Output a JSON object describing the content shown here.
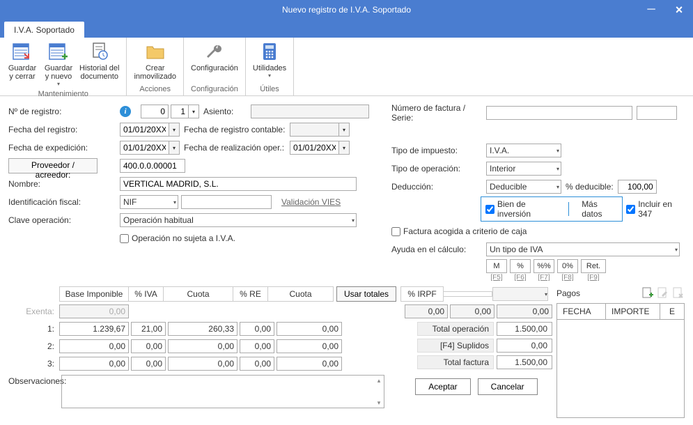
{
  "title": "Nuevo registro de I.V.A. Soportado",
  "tabs": {
    "iva_soportado": "I.V.A. Soportado"
  },
  "ribbon": {
    "mantenimiento": {
      "guardar_cerrar": "Guardar\ny cerrar",
      "guardar_nuevo": "Guardar\ny nuevo",
      "historial": "Historial del\ndocumento",
      "title": "Mantenimiento"
    },
    "acciones": {
      "crear_inmov": "Crear\ninmovilizado",
      "title": "Acciones"
    },
    "configuracion": {
      "config": "Configuración",
      "title": "Configuración"
    },
    "utiles": {
      "utilidades": "Utilidades",
      "title": "Útiles"
    }
  },
  "labels": {
    "n_registro": "Nº de registro:",
    "fecha_registro": "Fecha del registro:",
    "fecha_expedicion": "Fecha de expedición:",
    "proveedor": "Proveedor / acreedor:",
    "nombre": "Nombre:",
    "id_fiscal": "Identificación fiscal:",
    "clave_op": "Clave operación:",
    "asiento": "Asiento:",
    "fecha_reg_contable": "Fecha de registro contable:",
    "fecha_real_oper": "Fecha de realización oper.:",
    "op_no_sujeta": "Operación no sujeta a I.V.A.",
    "num_factura": "Número de factura / Serie:",
    "tipo_impuesto": "Tipo de impuesto:",
    "tipo_operacion": "Tipo de operación:",
    "deduccion": "Deducción:",
    "pct_deducible": "% deducible:",
    "bien_inversion": "Bien de inversión",
    "mas_datos": "Más datos",
    "incluir_347": "Incluir en 347",
    "factura_caja": "Factura acogida a criterio de caja",
    "ayuda_calculo": "Ayuda en el cálculo:",
    "validacion_vies": "Validación VIES",
    "observaciones": "Observaciones:",
    "usar_totales": "Usar totales",
    "pagos": "Pagos"
  },
  "values": {
    "n_registro_a": "0",
    "n_registro_b": "1",
    "fecha_registro": "01/01/20XX",
    "fecha_expedicion": "01/01/20XX",
    "fecha_real_oper": "01/01/20XX",
    "proveedor": "400.0.0.00001",
    "nombre": "VERTICAL MADRID, S.L.",
    "id_fiscal_tipo": "NIF",
    "clave_op": "Operación habitual",
    "tipo_impuesto": "I.V.A.",
    "tipo_operacion": "Interior",
    "deduccion": "Deducible",
    "pct_deducible": "100,00",
    "ayuda_calculo": "Un tipo de IVA",
    "incluir_347": true,
    "bien_inversion": true
  },
  "calc_btns": {
    "m": "M",
    "pct": "%",
    "pctpct": "%%",
    "zero": "0%",
    "ret": "Ret.",
    "f5": "[F5]",
    "f6": "[F6]",
    "f7": "[F7]",
    "f8": "[F8]",
    "f9": "[F9]"
  },
  "grid": {
    "headers": {
      "base": "Base Imponible",
      "pct_iva": "% IVA",
      "cuota": "Cuota",
      "pct_re": "% RE",
      "cuota2": "Cuota",
      "pct_irpf": "% IRPF"
    },
    "rows": {
      "exenta": {
        "label": "Exenta:",
        "base": "0,00"
      },
      "r1": {
        "label": "1:",
        "base": "1.239,67",
        "piva": "21,00",
        "cuota": "260,33",
        "pre": "0,00",
        "cuota2": "0,00"
      },
      "r2": {
        "label": "2:",
        "base": "0,00",
        "piva": "0,00",
        "cuota": "0,00",
        "pre": "0,00",
        "cuota2": "0,00"
      },
      "r3": {
        "label": "3:",
        "base": "0,00",
        "piva": "0,00",
        "cuota": "0,00",
        "pre": "0,00",
        "cuota2": "0,00"
      }
    },
    "irpf_vals": {
      "a": "0,00",
      "b": "0,00",
      "c": "0,00"
    }
  },
  "totals": {
    "total_op_label": "Total operación",
    "total_op": "1.500,00",
    "suplidos_label": "[F4] Suplidos",
    "suplidos": "0,00",
    "total_fac_label": "Total factura",
    "total_fac": "1.500,00"
  },
  "pagos_grid": {
    "fecha": "FECHA",
    "importe": "IMPORTE",
    "e": "E"
  },
  "dialog": {
    "aceptar": "Aceptar",
    "cancelar": "Cancelar"
  }
}
